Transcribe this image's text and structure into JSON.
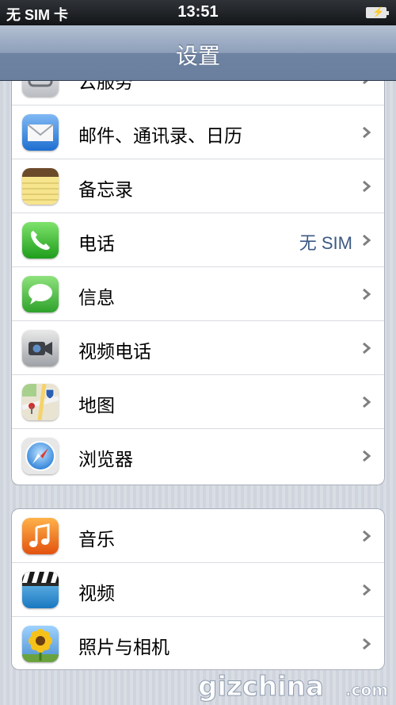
{
  "status": {
    "carrier": "无 SIM 卡",
    "time": "13:51"
  },
  "nav": {
    "title": "设置"
  },
  "group1": [
    {
      "label": "云服务",
      "icon": "cloud-icon"
    },
    {
      "label": "邮件、通讯录、日历",
      "icon": "mail-icon"
    },
    {
      "label": "备忘录",
      "icon": "notes-icon"
    },
    {
      "label": "电话",
      "icon": "phone-icon",
      "detail": "无 SIM"
    },
    {
      "label": "信息",
      "icon": "messages-icon"
    },
    {
      "label": "视频电话",
      "icon": "facetime-icon"
    },
    {
      "label": "地图",
      "icon": "maps-icon"
    },
    {
      "label": "浏览器",
      "icon": "safari-icon"
    }
  ],
  "group2": [
    {
      "label": "音乐",
      "icon": "music-icon"
    },
    {
      "label": "视频",
      "icon": "videos-icon"
    },
    {
      "label": "照片与相机",
      "icon": "photos-icon"
    }
  ],
  "watermark": {
    "text": "gizchina",
    "suffix": ".com"
  }
}
